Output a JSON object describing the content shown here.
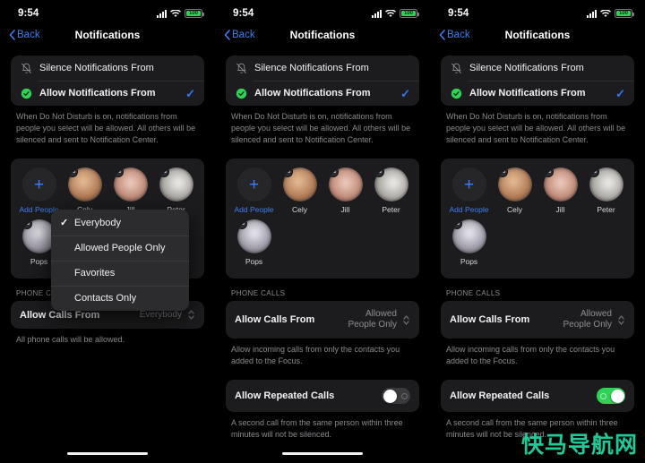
{
  "status_bar": {
    "time": "9:54",
    "signal_icon": "cellular-signal-icon",
    "wifi_icon": "wifi-icon",
    "battery_icon": "battery-icon",
    "battery_level": "100"
  },
  "nav": {
    "back_label": "Back",
    "back_icon": "chevron-left-icon",
    "title": "Notifications"
  },
  "notifications_card": {
    "rows": [
      {
        "label": "Silence Notifications From",
        "icon": "bell-slash-icon",
        "selected": false
      },
      {
        "label": "Allow Notifications From",
        "icon": "checkmark-seal-icon",
        "selected": true
      }
    ],
    "check_icon": "checkmark-icon",
    "footnote": "When Do Not Disturb is on, notifications from people you select will be allowed. All others will be silenced and sent to Notification Center."
  },
  "people": {
    "items": [
      {
        "name": "Add People",
        "type": "add",
        "icon": "plus-icon"
      },
      {
        "name": "Cely",
        "type": "person",
        "badge_icon": "minus-badge-icon"
      },
      {
        "name": "Jill",
        "type": "person",
        "badge_icon": "minus-badge-icon"
      },
      {
        "name": "Peter",
        "type": "person",
        "badge_icon": "minus-badge-icon"
      },
      {
        "name": "Pops",
        "type": "person",
        "badge_icon": "minus-badge-icon"
      }
    ]
  },
  "phone_calls": {
    "section_header": "PHONE CALLS",
    "allow_calls_label": "Allow Calls From",
    "stepper_icon": "up-down-chevron-icon",
    "repeated_label": "Allow Repeated Calls",
    "repeated_footnote": "A second call from the same person within three minutes will not be silenced."
  },
  "panels": [
    {
      "id": "panel-1",
      "calls_value": "Everybody",
      "calls_footnote": "All phone calls will be allowed.",
      "show_repeated": false,
      "repeated_on": false,
      "menu_open": true,
      "home_indicator": true
    },
    {
      "id": "panel-2",
      "calls_value": "Allowed\nPeople Only",
      "calls_footnote": "Allow incoming calls from only the contacts you added to the Focus.",
      "show_repeated": true,
      "repeated_on": false,
      "menu_open": false,
      "home_indicator": true
    },
    {
      "id": "panel-3",
      "calls_value": "Allowed\nPeople Only",
      "calls_footnote": "Allow incoming calls from only the contacts you added to the Focus.",
      "show_repeated": true,
      "repeated_on": true,
      "menu_open": false,
      "home_indicator": false
    }
  ],
  "context_menu": {
    "items": [
      {
        "label": "Everybody",
        "checked": true
      },
      {
        "label": "Allowed People Only",
        "checked": false
      },
      {
        "label": "Favorites",
        "checked": false
      },
      {
        "label": "Contacts Only",
        "checked": false
      }
    ],
    "check_icon": "checkmark-icon"
  },
  "watermark": {
    "text": "快马导航网",
    "color": "#20c997"
  },
  "colors": {
    "accent_blue": "#3b7ff0",
    "toggle_green": "#31d158",
    "card_bg": "#1c1c1e",
    "menu_bg": "#2c2c2e",
    "background": "#000000"
  }
}
